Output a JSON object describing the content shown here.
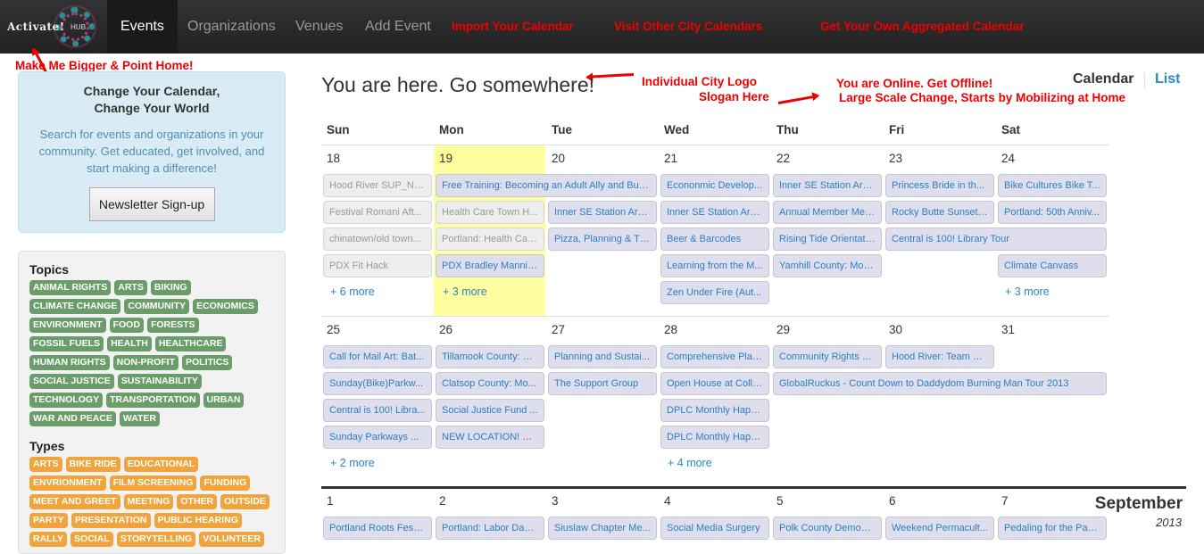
{
  "nav": {
    "logo_text": "Activate!",
    "logo_sub": "HUB",
    "items": [
      {
        "label": "Events",
        "active": true
      },
      {
        "label": "Organizations",
        "active": false
      },
      {
        "label": "Venues",
        "active": false
      },
      {
        "label": "Add Event",
        "active": false
      }
    ],
    "red_items": [
      {
        "label": "Import Your Calendar"
      },
      {
        "label": "Visit Other City Calendars"
      },
      {
        "label": "Get Your Own Aggregated Calendar"
      }
    ]
  },
  "annotations": {
    "logo_note": "Make Me Bigger & Point Home!",
    "city_logo": "Individual City Logo",
    "slogan_here": "Slogan Here",
    "online_1": "You are Online. Get Offline!",
    "online_2": "Large Scale Change, Starts by Mobilizing at Home"
  },
  "hero": {
    "title_1": "Change Your Calendar,",
    "title_2": "Change Your World",
    "body": "Search for events and organizations in your community. Get educated, get involved, and start making a difference!",
    "button": "Newsletter Sign-up"
  },
  "filters": {
    "topics_title": "Topics",
    "topics": [
      "ANIMAL RIGHTS",
      "ARTS",
      "BIKING",
      "CLIMATE CHANGE",
      "COMMUNITY",
      "ECONOMICS",
      "ENVIRONMENT",
      "FOOD",
      "FORESTS",
      "FOSSIL FUELS",
      "HEALTH",
      "HEALTHCARE",
      "HUMAN RIGHTS",
      "NON-PROFIT",
      "POLITICS",
      "SOCIAL JUSTICE",
      "SUSTAINABILITY",
      "TECHNOLOGY",
      "TRANSPORTATION",
      "URBAN",
      "WAR AND PEACE",
      "WATER"
    ],
    "types_title": "Types",
    "types": [
      "ARTS",
      "BIKE RIDE",
      "EDUCATIONAL",
      "ENVRIONMENT",
      "FILM SCREENING",
      "FUNDING",
      "MEET AND GREET",
      "MEETING",
      "OTHER",
      "OUTSIDE",
      "PARTY",
      "PRESENTATION",
      "PUBLIC HEARING",
      "RALLY",
      "SOCIAL",
      "STORYTELLING",
      "VOLUNTEER"
    ]
  },
  "main": {
    "title": "You are here. Go somewhere!",
    "view_calendar": "Calendar",
    "view_list": "List"
  },
  "calendar": {
    "weekdays": [
      "Sun",
      "Mon",
      "Tue",
      "Wed",
      "Thu",
      "Fri",
      "Sat"
    ],
    "today_col": 1,
    "weeks": [
      {
        "days": [
          "18",
          "19",
          "20",
          "21",
          "22",
          "23",
          "24"
        ],
        "events": [
          {
            "title": "Hood River SUP_NA...",
            "col": 0,
            "row": 0,
            "span": 1,
            "past": true
          },
          {
            "title": "Free Training: Becoming an Adult Ally and Buil...",
            "col": 1,
            "row": 0,
            "span": 2,
            "past": false
          },
          {
            "title": "Econonmic Develop...",
            "col": 3,
            "row": 0,
            "span": 1,
            "past": false
          },
          {
            "title": "Inner SE Station Are...",
            "col": 4,
            "row": 0,
            "span": 1,
            "past": false
          },
          {
            "title": "Princess Bride in th...",
            "col": 5,
            "row": 0,
            "span": 1,
            "past": false
          },
          {
            "title": "Bike Cultures Bike T...",
            "col": 6,
            "row": 0,
            "span": 1,
            "past": false
          },
          {
            "title": "Festival Romani Aft...",
            "col": 0,
            "row": 1,
            "span": 1,
            "past": true
          },
          {
            "title": "Health Care Town H...",
            "col": 1,
            "row": 1,
            "span": 1,
            "past": true
          },
          {
            "title": "Inner SE Station Are...",
            "col": 2,
            "row": 1,
            "span": 1,
            "past": false
          },
          {
            "title": "Inner SE Station Are...",
            "col": 3,
            "row": 1,
            "span": 1,
            "past": false
          },
          {
            "title": "Annual Member Mee...",
            "col": 4,
            "row": 1,
            "span": 1,
            "past": false
          },
          {
            "title": "Rocky Butte Sunset ...",
            "col": 5,
            "row": 1,
            "span": 1,
            "past": false
          },
          {
            "title": "Portland: 50th Anniv...",
            "col": 6,
            "row": 1,
            "span": 1,
            "past": false
          },
          {
            "title": "chinatown/old town...",
            "col": 0,
            "row": 2,
            "span": 1,
            "past": true
          },
          {
            "title": "Portland: Health Car...",
            "col": 1,
            "row": 2,
            "span": 1,
            "past": true
          },
          {
            "title": "Pizza, Planning & Th...",
            "col": 2,
            "row": 2,
            "span": 1,
            "past": false
          },
          {
            "title": "Beer & Barcodes",
            "col": 3,
            "row": 2,
            "span": 1,
            "past": false
          },
          {
            "title": "Rising Tide Orientation",
            "col": 4,
            "row": 2,
            "span": 1,
            "past": false
          },
          {
            "title": "Central is 100! Library Tour",
            "col": 5,
            "row": 2,
            "span": 2,
            "past": false
          },
          {
            "title": "PDX Fit Hack",
            "col": 0,
            "row": 3,
            "span": 1,
            "past": true
          },
          {
            "title": "PDX Bradley Mannin...",
            "col": 1,
            "row": 3,
            "span": 1,
            "past": false
          },
          {
            "title": "Learning from the M...",
            "col": 3,
            "row": 3,
            "span": 1,
            "past": false
          },
          {
            "title": "Yamhill County: Mon...",
            "col": 4,
            "row": 3,
            "span": 1,
            "past": false
          },
          {
            "title": "Climate Canvass",
            "col": 6,
            "row": 3,
            "span": 1,
            "past": false
          },
          {
            "title": "Zen Under Fire (Aut...",
            "col": 3,
            "row": 4,
            "span": 1,
            "past": false
          }
        ],
        "more": [
          {
            "label": "+ 6 more",
            "col": 0,
            "row": 4
          },
          {
            "label": "+ 3 more",
            "col": 1,
            "row": 4
          },
          {
            "label": "+ 3 more",
            "col": 6,
            "row": 4
          }
        ]
      },
      {
        "days": [
          "25",
          "26",
          "27",
          "28",
          "29",
          "30",
          "31"
        ],
        "events": [
          {
            "title": "Call for Mail Art: Bat...",
            "col": 0,
            "row": 0,
            "span": 1,
            "past": false
          },
          {
            "title": "Tillamook County: M...",
            "col": 1,
            "row": 0,
            "span": 1,
            "past": false
          },
          {
            "title": "Planning and Sustai...",
            "col": 2,
            "row": 0,
            "span": 1,
            "past": false
          },
          {
            "title": "Comprehensive Plan...",
            "col": 3,
            "row": 0,
            "span": 1,
            "past": false
          },
          {
            "title": "Community Rights O...",
            "col": 4,
            "row": 0,
            "span": 1,
            "past": false
          },
          {
            "title": "Hood River: Team M...",
            "col": 5,
            "row": 0,
            "span": 1,
            "past": false
          },
          {
            "title": "Sunday(Bike)Parkw...",
            "col": 0,
            "row": 1,
            "span": 1,
            "past": false
          },
          {
            "title": "Clatsop County: Mo...",
            "col": 1,
            "row": 1,
            "span": 1,
            "past": false
          },
          {
            "title": "The Support Group",
            "col": 2,
            "row": 1,
            "span": 1,
            "past": false
          },
          {
            "title": "Open House at Colle...",
            "col": 3,
            "row": 1,
            "span": 1,
            "past": false
          },
          {
            "title": "GlobalRuckus - Count Down to Daddydom Burning Man Tour 2013",
            "col": 4,
            "row": 1,
            "span": 3,
            "past": false
          },
          {
            "title": "Central is 100! Libra...",
            "col": 0,
            "row": 2,
            "span": 1,
            "past": false
          },
          {
            "title": "Social Justice Fund ...",
            "col": 1,
            "row": 2,
            "span": 1,
            "past": false
          },
          {
            "title": "DPLC Monthly Happ...",
            "col": 3,
            "row": 2,
            "span": 1,
            "past": false
          },
          {
            "title": "Sunday Parkways ...",
            "col": 0,
            "row": 3,
            "span": 1,
            "past": false
          },
          {
            "title": "NEW LOCATION! So...",
            "col": 1,
            "row": 3,
            "span": 1,
            "past": false
          },
          {
            "title": "DPLC Monthly Happ...",
            "col": 3,
            "row": 3,
            "span": 1,
            "past": false
          }
        ],
        "more": [
          {
            "label": "+ 2 more",
            "col": 0,
            "row": 4
          },
          {
            "label": "+ 4 more",
            "col": 3,
            "row": 4
          }
        ]
      },
      {
        "days": [
          "1",
          "2",
          "3",
          "4",
          "5",
          "6",
          "7"
        ],
        "events": [
          {
            "title": "Portland Roots Festival",
            "col": 0,
            "row": 0,
            "span": 1,
            "past": false
          },
          {
            "title": "Portland: Labor Day ...",
            "col": 1,
            "row": 0,
            "span": 1,
            "past": false
          },
          {
            "title": "Siuslaw Chapter Me...",
            "col": 2,
            "row": 0,
            "span": 1,
            "past": false
          },
          {
            "title": "Social Media Surgery",
            "col": 3,
            "row": 0,
            "span": 1,
            "past": false
          },
          {
            "title": "Polk County Democr...",
            "col": 4,
            "row": 0,
            "span": 1,
            "past": false
          },
          {
            "title": "Weekend Permacult...",
            "col": 5,
            "row": 0,
            "span": 1,
            "past": false
          },
          {
            "title": "Pedaling for the Pas...",
            "col": 6,
            "row": 0,
            "span": 1,
            "past": false
          }
        ],
        "more": []
      }
    ],
    "next_month": "September",
    "next_year": "2013"
  }
}
